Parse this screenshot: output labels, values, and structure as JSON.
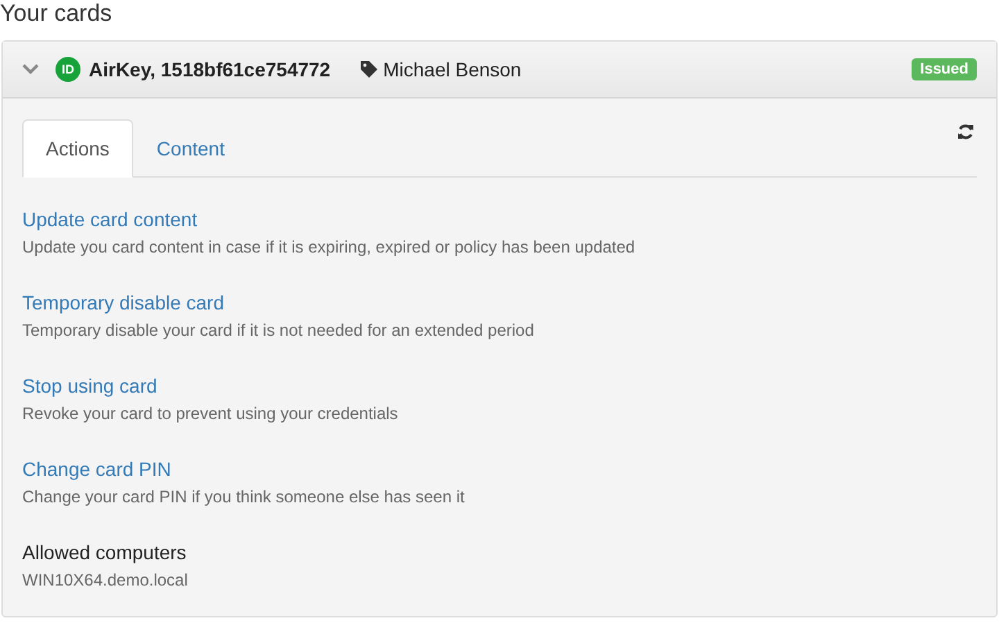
{
  "heading": "Your cards",
  "card": {
    "expanded": true,
    "logo_text": "ID",
    "name": "AirKey, 1518bf61ce754772",
    "owner": "Michael Benson",
    "status": "Issued",
    "tabs": [
      {
        "label": "Actions",
        "selected": true
      },
      {
        "label": "Content",
        "selected": false
      }
    ],
    "items": [
      {
        "kind": "action",
        "title": "Update card content",
        "description": "Update you card content in case if it is expiring, expired or policy has been updated"
      },
      {
        "kind": "action",
        "title": "Temporary disable card",
        "description": "Temporary disable your card if it is not needed for an extended period"
      },
      {
        "kind": "action",
        "title": "Stop using card",
        "description": "Revoke your card to prevent using your credentials"
      },
      {
        "kind": "action",
        "title": "Change card PIN",
        "description": "Change your card PIN if you think someone else has seen it"
      },
      {
        "kind": "info",
        "title": "Allowed computers",
        "description": "WIN10X64.demo.local"
      }
    ]
  }
}
